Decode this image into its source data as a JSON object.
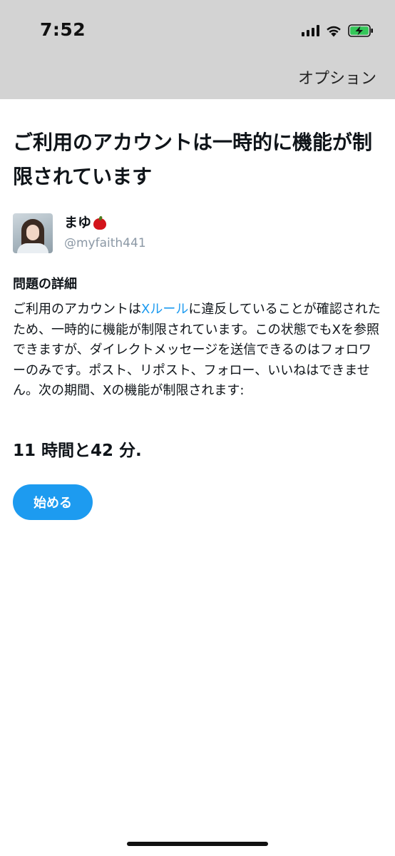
{
  "status_bar": {
    "time": "7:52",
    "icons": [
      "cellular-signal-icon",
      "wifi-icon",
      "battery-charging-icon"
    ],
    "battery_color": "#34c759"
  },
  "header": {
    "options_label": "オプション"
  },
  "main": {
    "title": "ご利用のアカウントは一時的に機能が制限されています",
    "user": {
      "display_name": "まゆ",
      "emoji": "red-apple-icon",
      "handle": "@myfaith441"
    },
    "details_heading": "問題の詳細",
    "details": {
      "before_link": "ご利用のアカウントは",
      "link_text": "Xルール",
      "after_link": "に違反していることが確認されたため、一時的に機能が制限されています。この状態でもXを参照できますが、ダイレクトメッセージを送信できるのはフォロワーのみです。ポスト、リポスト、フォロー、いいねはできません。次の期間、Xの機能が制限されます:"
    },
    "duration": "11 時間と42 分.",
    "start_button_label": "始める"
  },
  "colors": {
    "accent": "#1d9bf0",
    "header_background": "#d3d3d3",
    "text": "#0f1419",
    "handle": "#8b98a5"
  }
}
